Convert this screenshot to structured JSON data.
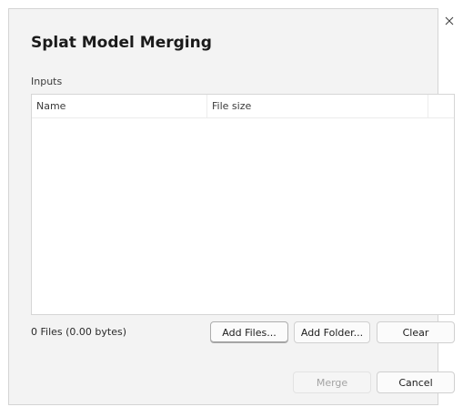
{
  "dialog": {
    "title": "Splat Model Merging",
    "close_icon": "close-icon"
  },
  "inputs": {
    "label": "Inputs",
    "columns": [
      "Name",
      "File size",
      ""
    ],
    "rows": []
  },
  "status": {
    "summary": "0 Files (0.00 bytes)"
  },
  "buttons": {
    "add_files": "Add Files...",
    "add_folder": "Add Folder...",
    "clear": "Clear",
    "merge": "Merge",
    "cancel": "Cancel"
  },
  "colors": {
    "dialog_bg": "#f3f3f3",
    "table_bg": "#ffffff",
    "disabled_text": "#a3a3a3"
  }
}
